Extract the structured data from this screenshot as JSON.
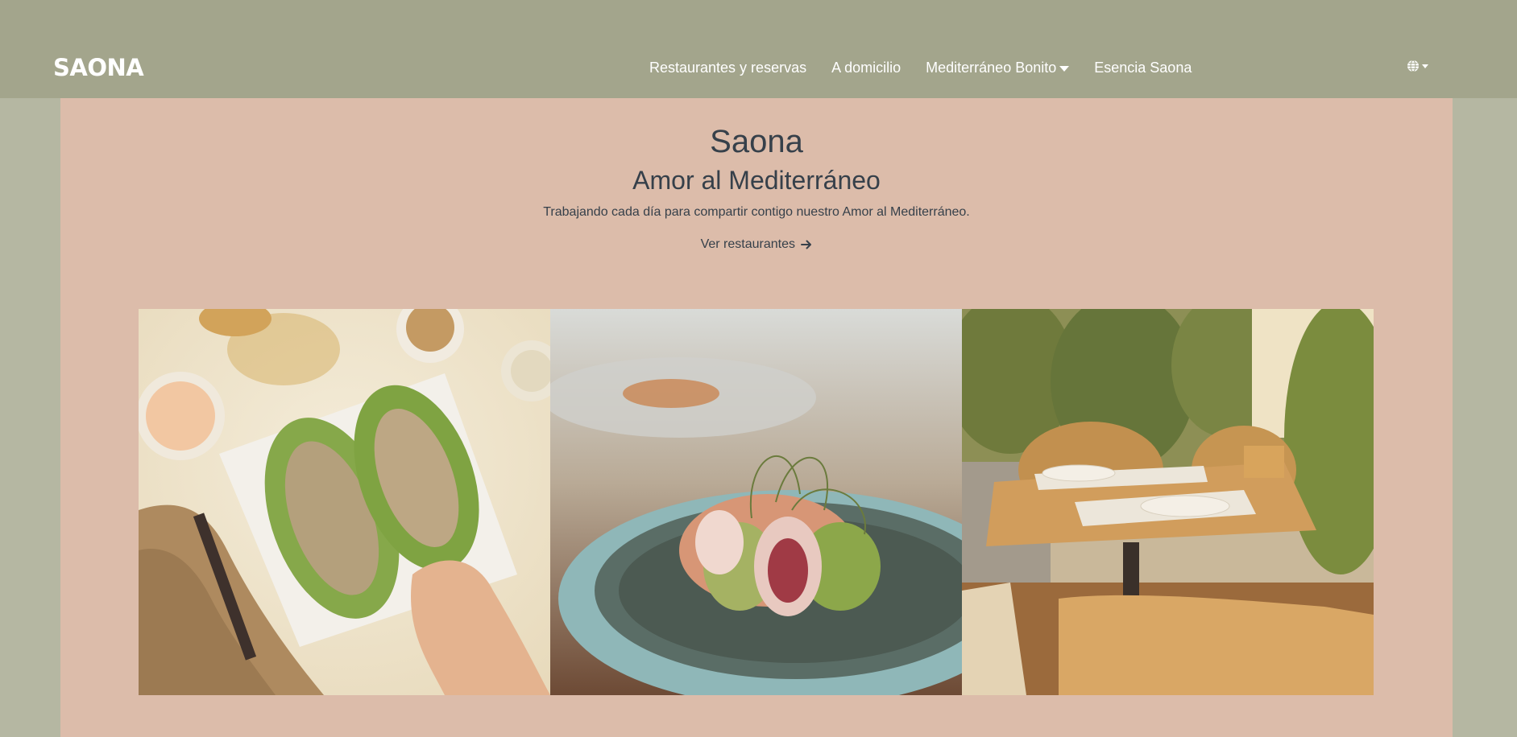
{
  "brand": {
    "logo_text": "SAONA"
  },
  "nav": {
    "items": [
      {
        "label": "Restaurantes y reservas",
        "has_dropdown": false
      },
      {
        "label": "A domicilio",
        "has_dropdown": false
      },
      {
        "label": "Mediterráneo Bonito",
        "has_dropdown": true
      },
      {
        "label": "Esencia Saona",
        "has_dropdown": false
      }
    ],
    "language_icon": "globe-icon"
  },
  "hero": {
    "title": "Saona",
    "subtitle": "Amor al Mediterráneo",
    "text": "Trabajando cada día para compartir contigo nuestro Amor al Mediterráneo.",
    "cta_label": "Ver restaurantes",
    "cta_icon": "arrow-right-icon"
  },
  "gallery": {
    "photos": [
      {
        "name": "lettuce-wraps-photo"
      },
      {
        "name": "fig-prosciutto-dish-photo"
      },
      {
        "name": "terrace-table-photo"
      }
    ]
  },
  "colors": {
    "navbar_bg": "#a3a58c",
    "page_bg": "#b5b7a2",
    "content_bg": "#dcbcaa",
    "text_dark": "#36404a",
    "nav_text": "#ffffff"
  }
}
